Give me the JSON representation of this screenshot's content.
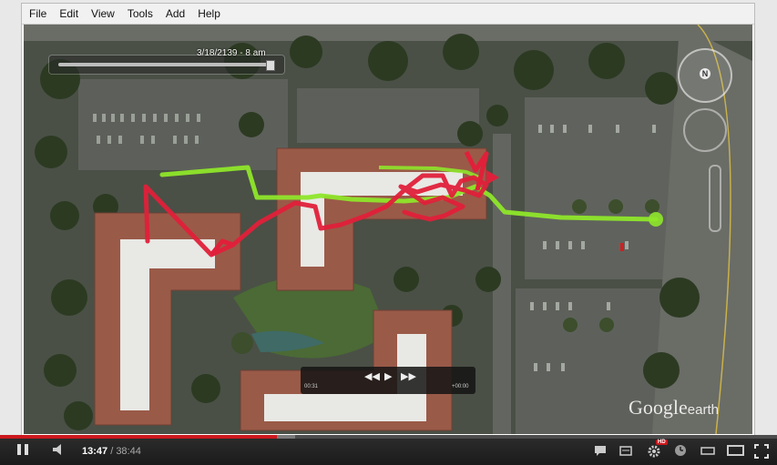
{
  "menu": [
    "File",
    "Edit",
    "View",
    "Tools",
    "Add",
    "Help"
  ],
  "time_slider": {
    "label": "3/18/2139 - 8 am"
  },
  "compass": {
    "north_label": "N"
  },
  "tour_player": {
    "rewind": "◀◀",
    "play": "▶",
    "forward": "▶▶",
    "elapsed": "00:31",
    "remaining": "+00:00"
  },
  "watermark": {
    "brand": "Google",
    "suffix": "earth"
  },
  "video": {
    "current_time": "13:47",
    "separator": " / ",
    "total_time": "38:44",
    "progress": 0.356,
    "loaded": 0.38,
    "hd_badge": "HD"
  },
  "colors": {
    "path_red": "#e0203a",
    "path_green": "#8ee62a",
    "progress": "#cc181e"
  }
}
